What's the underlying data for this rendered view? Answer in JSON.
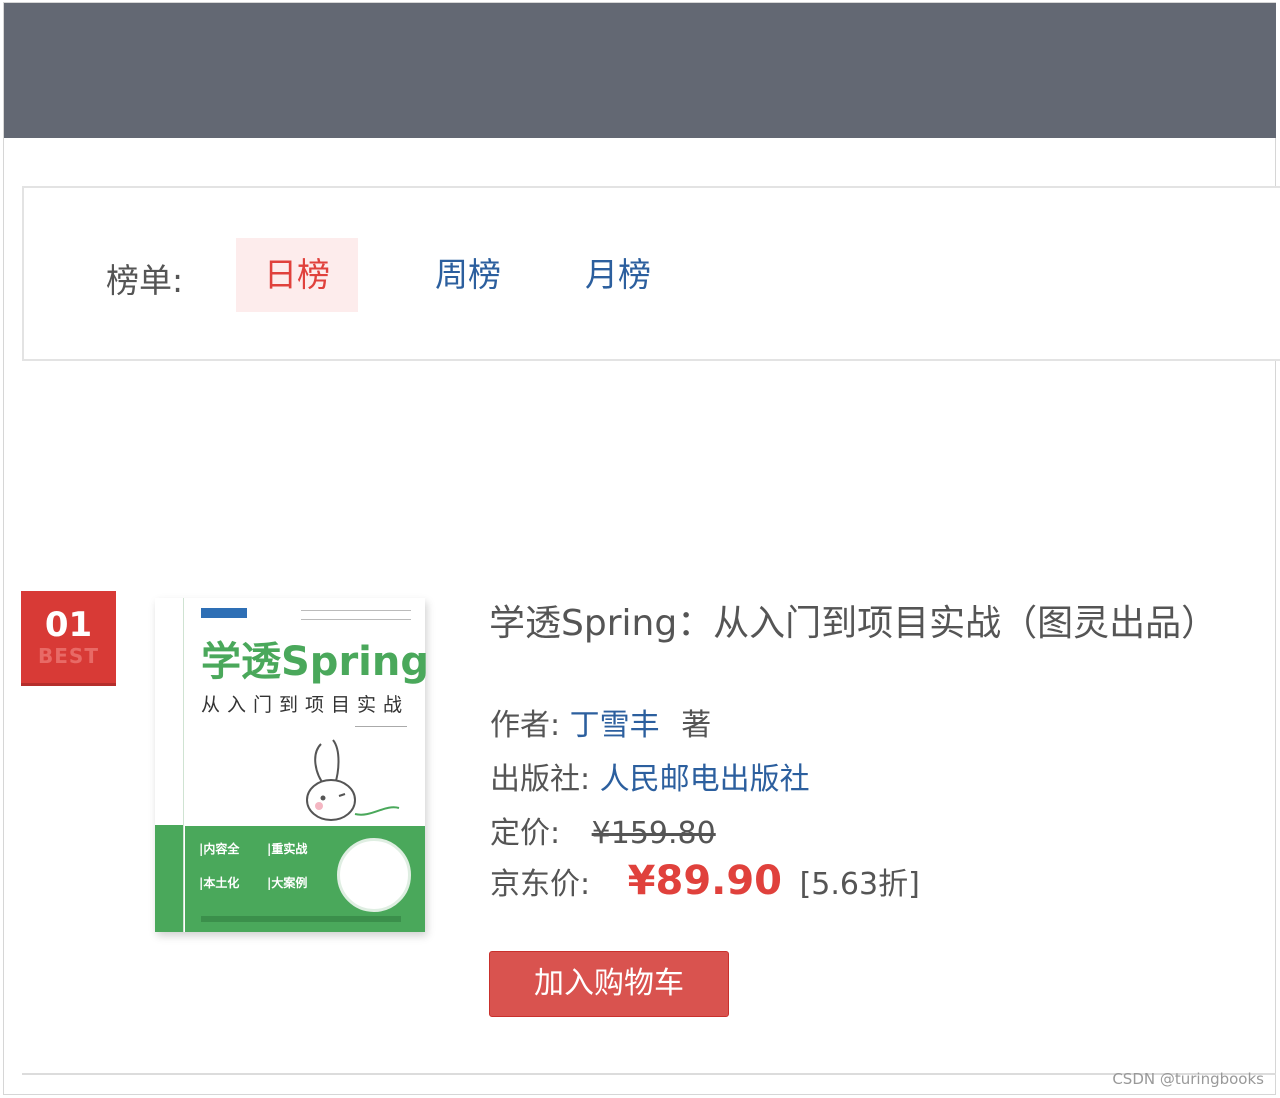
{
  "ranking": {
    "label": "榜单:",
    "tabs": [
      {
        "label": "日榜",
        "active": true
      },
      {
        "label": "周榜",
        "active": false
      },
      {
        "label": "月榜",
        "active": false
      }
    ]
  },
  "item": {
    "rank": "01",
    "rank_tag": "BEST",
    "title": "学透Spring：从入门到项目实战（图灵出品）",
    "author_label": "作者:",
    "author": "丁雪丰",
    "author_suffix": "著",
    "publisher_label": "出版社:",
    "publisher": "人民邮电出版社",
    "list_price_label": "定价:",
    "list_price": "¥159.80",
    "jd_price_label": "京东价:",
    "jd_price": "¥89.90",
    "discount": "[5.63折]",
    "cart_button": "加入购物车"
  },
  "cover": {
    "title": "学透Spring",
    "subtitle": "从入门到项目实战",
    "points": [
      "|内容全",
      "|重实战",
      "|本土化",
      "|大案例"
    ]
  },
  "watermark": "CSDN @turingbooks",
  "colors": {
    "topbar": "#636873",
    "accent_red": "#e0413c",
    "link_blue": "#2c5f9e",
    "cover_green": "#4aa85b"
  }
}
